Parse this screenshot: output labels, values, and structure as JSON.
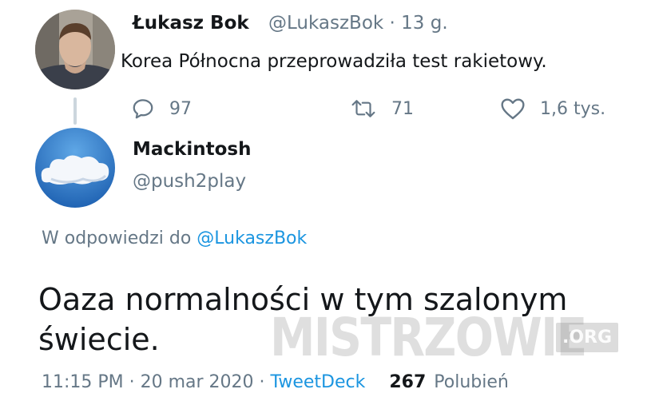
{
  "parent_tweet": {
    "author_name": "Łukasz Bok",
    "author_handle": "@LukaszBok",
    "time_ago": "· 13 g.",
    "text": "Korea Północna przeprowadziła test rakietowy.",
    "reply_count": "97",
    "retweet_count": "71",
    "like_count": "1,6 tys.",
    "icons": {
      "reply": "reply-icon",
      "retweet": "retweet-icon",
      "like": "heart-icon"
    }
  },
  "reply_tweet": {
    "author_name": "Mackintosh",
    "author_handle": "@push2play",
    "replying_prefix": "W odpowiedzi do",
    "replying_to": "@LukaszBok",
    "text": "Oaza normalności w tym szalonym świecie.",
    "timestamp": "11:15 PM · 20 mar 2020 · ",
    "source": "TweetDeck",
    "likes_count": "267",
    "likes_label": "Polubień"
  },
  "watermark": {
    "main": "MISTRZOWIE",
    "suffix": ".ORG"
  },
  "colors": {
    "link": "#1b95e0",
    "secondary": "#657786",
    "text": "#14171a",
    "thread_line": "#ccd6dd"
  }
}
